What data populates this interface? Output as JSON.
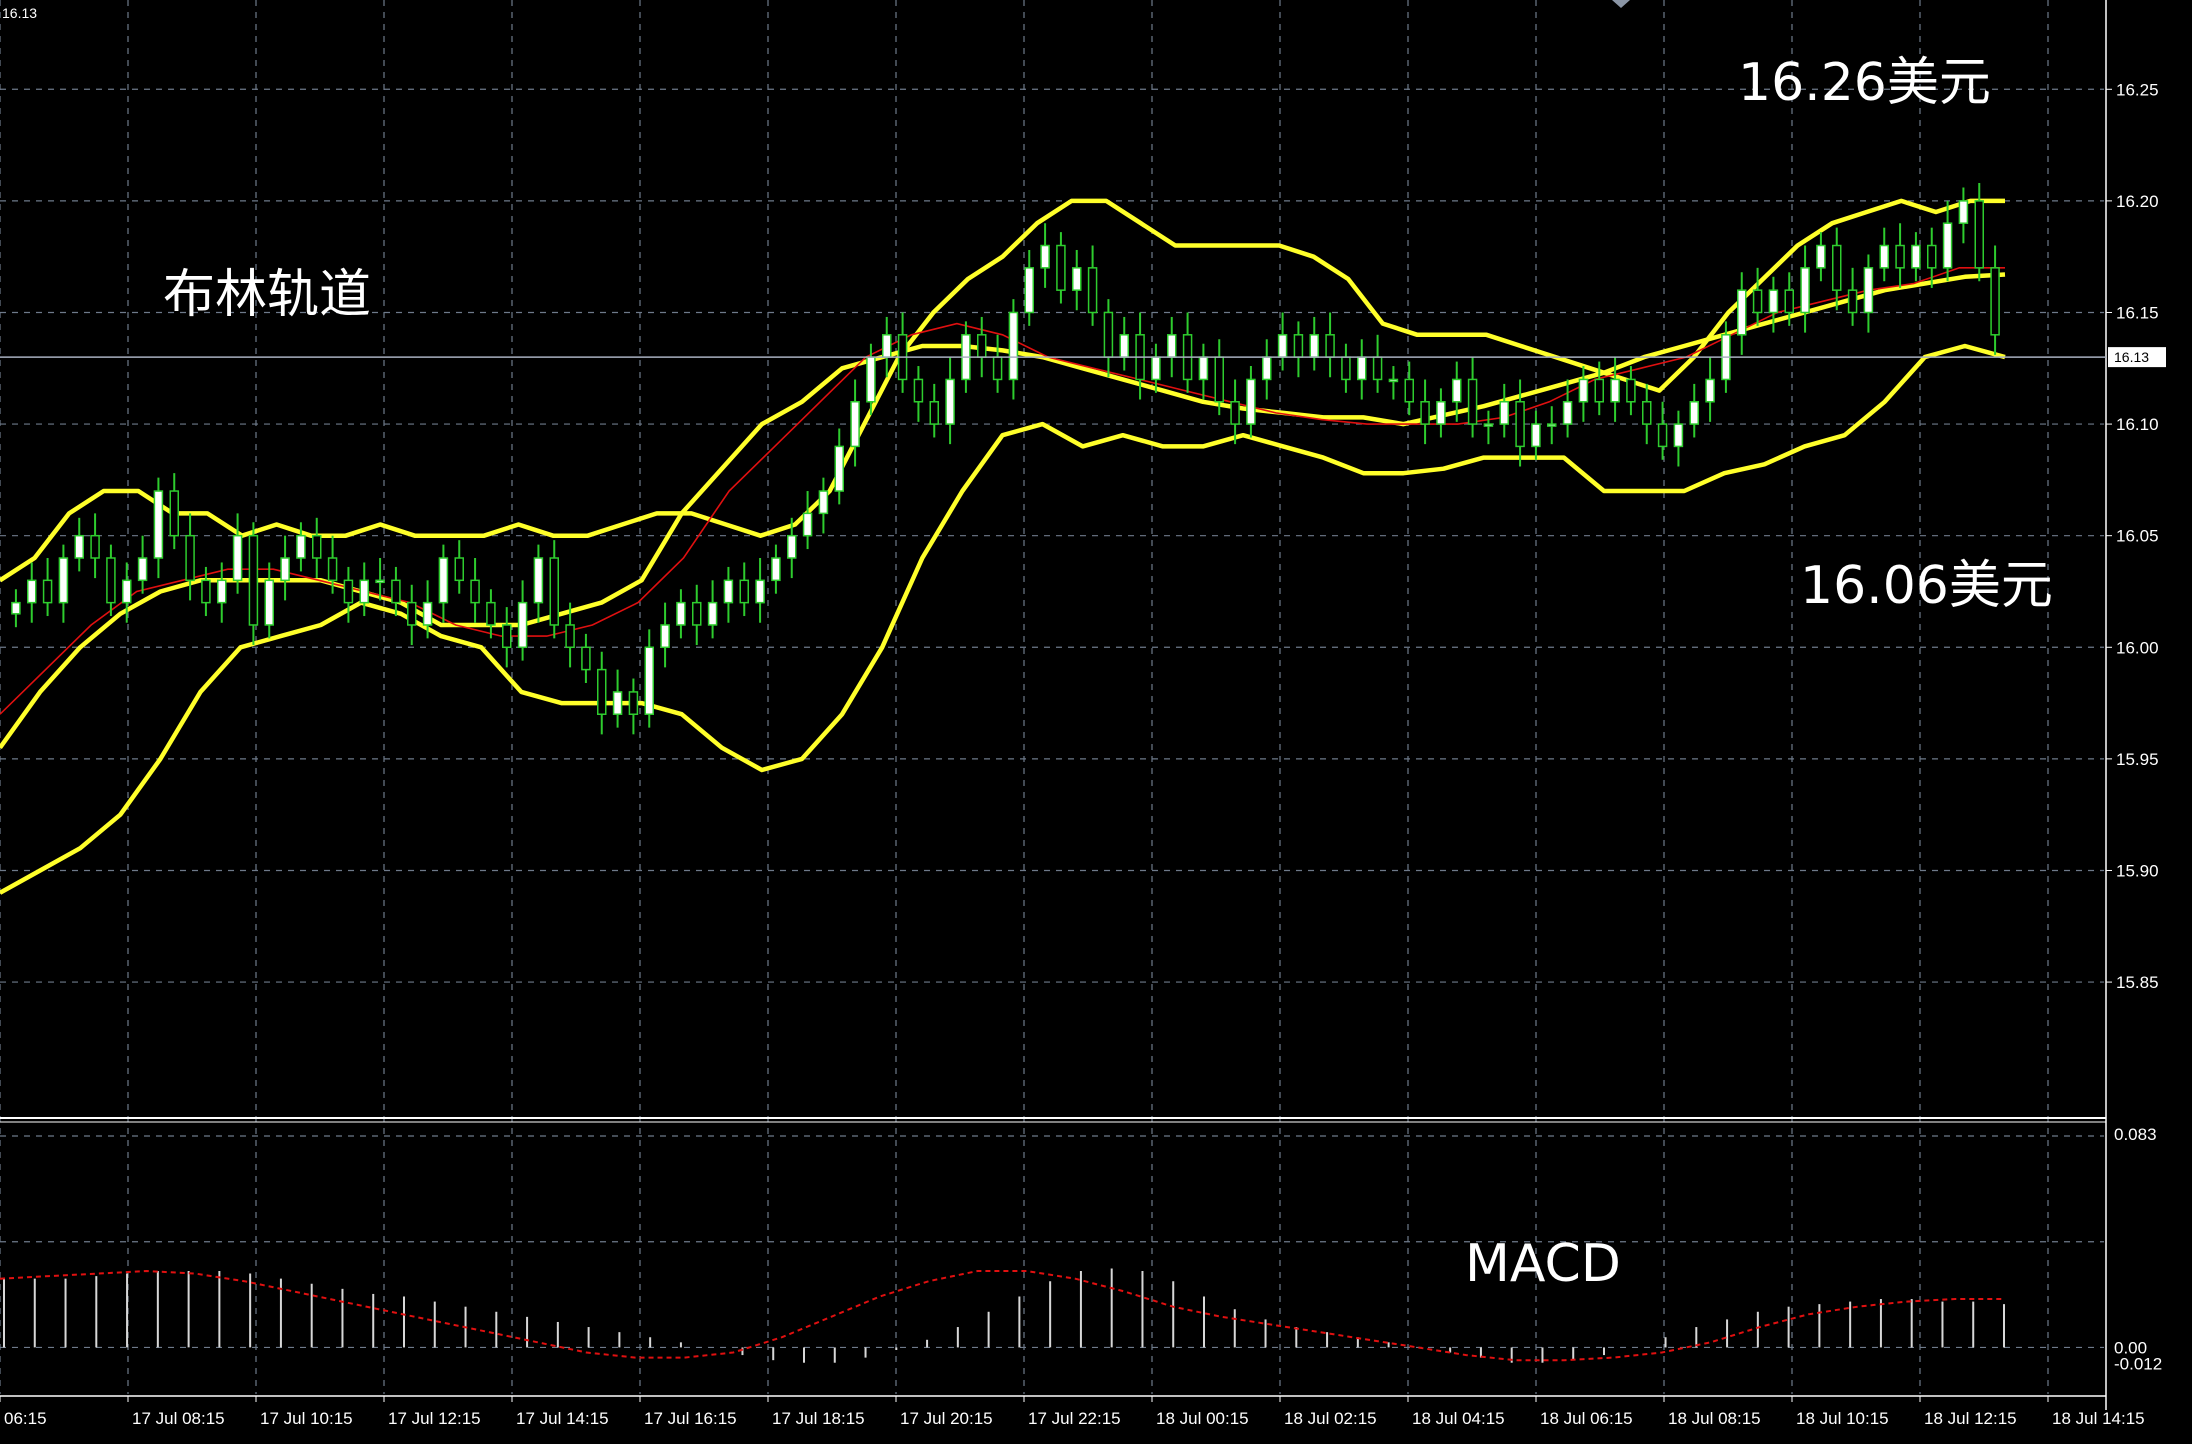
{
  "window": {
    "symbol_price": "16.13",
    "current_price_label": "16.13"
  },
  "annotations": {
    "bollinger": "布林轨道",
    "upper_price": "16.26美元",
    "lower_price": "16.06美元",
    "macd": "MACD"
  },
  "colors": {
    "background": "#000000",
    "grid": "#6e7a8a",
    "candle_body": "#ffffff",
    "candle_wick": "#2ecc2e",
    "bollinger": "#ffff2a",
    "moving_average": "#e01010",
    "macd_hist": "#d8d8d8",
    "macd_signal": "#e01010"
  },
  "chart_data": [
    {
      "type": "candlestick",
      "indicator": "Bollinger Bands",
      "ylim": [
        15.79,
        16.29
      ],
      "y_ticks": [
        15.85,
        15.9,
        15.95,
        16.0,
        16.05,
        16.1,
        16.15,
        16.2,
        16.25
      ],
      "y_tick_labels": [
        "15.85",
        "15.90",
        "15.95",
        "16.00",
        "16.05",
        "16.10",
        "16.15",
        "16.20",
        "16.25"
      ],
      "x_labels": [
        "06:15",
        "17 Jul 08:15",
        "17 Jul 10:15",
        "17 Jul 12:15",
        "17 Jul 14:15",
        "17 Jul 16:15",
        "17 Jul 18:15",
        "17 Jul 20:15",
        "17 Jul 22:15",
        "18 Jul 00:15",
        "18 Jul 02:15",
        "18 Jul 04:15",
        "18 Jul 06:15",
        "18 Jul 08:15",
        "18 Jul 10:15",
        "18 Jul 12:15",
        "18 Jul 14:15"
      ],
      "current_price": 16.13,
      "close": [
        16.02,
        16.03,
        16.02,
        16.04,
        16.05,
        16.04,
        16.02,
        16.03,
        16.04,
        16.07,
        16.05,
        16.03,
        16.02,
        16.03,
        16.05,
        16.01,
        16.03,
        16.04,
        16.05,
        16.04,
        16.03,
        16.02,
        16.03,
        16.03,
        16.02,
        16.01,
        16.02,
        16.04,
        16.03,
        16.02,
        16.01,
        16.0,
        16.02,
        16.04,
        16.01,
        16.0,
        15.99,
        15.97,
        15.98,
        15.97,
        16.0,
        16.01,
        16.02,
        16.01,
        16.02,
        16.03,
        16.02,
        16.03,
        16.04,
        16.05,
        16.06,
        16.07,
        16.09,
        16.11,
        16.13,
        16.14,
        16.12,
        16.11,
        16.1,
        16.12,
        16.14,
        16.13,
        16.12,
        16.15,
        16.17,
        16.18,
        16.16,
        16.17,
        16.15,
        16.13,
        16.14,
        16.12,
        16.13,
        16.14,
        16.12,
        16.13,
        16.11,
        16.1,
        16.12,
        16.13,
        16.14,
        16.13,
        16.14,
        16.13,
        16.12,
        16.13,
        16.12,
        16.12,
        16.11,
        16.1,
        16.11,
        16.12,
        16.1,
        16.1,
        16.11,
        16.09,
        16.1,
        16.1,
        16.11,
        16.12,
        16.11,
        16.12,
        16.11,
        16.1,
        16.09,
        16.1,
        16.11,
        16.12,
        16.14,
        16.16,
        16.15,
        16.16,
        16.15,
        16.17,
        16.18,
        16.16,
        16.15,
        16.17,
        16.18,
        16.17,
        16.18,
        16.17,
        16.19,
        16.2,
        16.17,
        16.14
      ],
      "bollinger_upper": [
        16.03,
        16.04,
        16.06,
        16.07,
        16.07,
        16.06,
        16.06,
        16.05,
        16.055,
        16.05,
        16.05,
        16.055,
        16.05,
        16.05,
        16.05,
        16.055,
        16.05,
        16.05,
        16.055,
        16.06,
        16.06,
        16.055,
        16.05,
        16.055,
        16.07,
        16.1,
        16.13,
        16.15,
        16.165,
        16.175,
        16.19,
        16.2,
        16.2,
        16.19,
        16.18,
        16.18,
        16.18,
        16.18,
        16.175,
        16.165,
        16.145,
        16.14,
        16.14,
        16.14,
        16.135,
        16.13,
        16.125,
        16.12,
        16.115,
        16.13,
        16.15,
        16.165,
        16.18,
        16.19,
        16.195,
        16.2,
        16.195,
        16.2,
        16.2
      ],
      "bollinger_middle": [
        15.955,
        15.98,
        16.0,
        16.015,
        16.025,
        16.03,
        16.03,
        16.03,
        16.03,
        16.025,
        16.02,
        16.01,
        16.01,
        16.01,
        16.015,
        16.02,
        16.03,
        16.06,
        16.08,
        16.1,
        16.11,
        16.125,
        16.13,
        16.135,
        16.135,
        16.133,
        16.13,
        16.125,
        16.12,
        16.115,
        16.11,
        16.107,
        16.105,
        16.103,
        16.103,
        16.1,
        16.104,
        16.108,
        16.113,
        16.118,
        16.123,
        16.13,
        16.135,
        16.14,
        16.145,
        16.15,
        16.155,
        16.16,
        16.163,
        16.166,
        16.167
      ],
      "moving_average": [
        15.97,
        15.99,
        16.01,
        16.025,
        16.03,
        16.035,
        16.035,
        16.03,
        16.025,
        16.02,
        16.01,
        16.005,
        16.005,
        16.01,
        16.02,
        16.04,
        16.07,
        16.09,
        16.11,
        16.13,
        16.14,
        16.145,
        16.14,
        16.13,
        16.125,
        16.12,
        16.115,
        16.11,
        16.105,
        16.102,
        16.1,
        16.1,
        16.1,
        16.103,
        16.11,
        16.12,
        16.125,
        16.13,
        16.14,
        16.15,
        16.155,
        16.16,
        16.163,
        16.17,
        16.17
      ],
      "bollinger_lower": [
        15.89,
        15.9,
        15.91,
        15.925,
        15.95,
        15.98,
        16.0,
        16.005,
        16.01,
        16.02,
        16.015,
        16.005,
        16.0,
        15.98,
        15.975,
        15.975,
        15.975,
        15.97,
        15.955,
        15.945,
        15.95,
        15.97,
        16.0,
        16.04,
        16.07,
        16.095,
        16.1,
        16.09,
        16.095,
        16.09,
        16.09,
        16.095,
        16.09,
        16.085,
        16.078,
        16.078,
        16.08,
        16.085,
        16.085,
        16.085,
        16.07,
        16.07,
        16.07,
        16.078,
        16.082,
        16.09,
        16.095,
        16.11,
        16.13,
        16.135,
        16.13
      ]
    },
    {
      "type": "bar",
      "indicator": "MACD",
      "ylim": [
        -0.012,
        0.083
      ],
      "y_tick_labels": [
        "0.083",
        "0.00",
        "-0.012"
      ],
      "histogram": [
        0.027,
        0.027,
        0.027,
        0.028,
        0.029,
        0.03,
        0.03,
        0.03,
        0.029,
        0.027,
        0.025,
        0.023,
        0.021,
        0.02,
        0.018,
        0.016,
        0.014,
        0.012,
        0.01,
        0.008,
        0.006,
        0.004,
        0.002,
        0.0,
        -0.003,
        -0.005,
        -0.006,
        -0.006,
        -0.004,
        -0.001,
        0.003,
        0.008,
        0.014,
        0.02,
        0.026,
        0.03,
        0.031,
        0.03,
        0.026,
        0.02,
        0.015,
        0.011,
        0.008,
        0.006,
        0.004,
        0.002,
        0.0,
        -0.002,
        -0.004,
        -0.006,
        -0.006,
        -0.005,
        -0.003,
        0.0,
        0.004,
        0.008,
        0.011,
        0.014,
        0.016,
        0.017,
        0.018,
        0.019,
        0.019,
        0.018,
        0.018,
        0.017
      ],
      "signal": [
        0.027,
        0.028,
        0.029,
        0.03,
        0.029,
        0.026,
        0.022,
        0.018,
        0.014,
        0.01,
        0.006,
        0.002,
        -0.002,
        -0.004,
        -0.004,
        -0.002,
        0.004,
        0.012,
        0.02,
        0.026,
        0.03,
        0.03,
        0.027,
        0.022,
        0.016,
        0.012,
        0.009,
        0.006,
        0.003,
        0.0,
        -0.003,
        -0.005,
        -0.005,
        -0.004,
        -0.002,
        0.002,
        0.008,
        0.013,
        0.016,
        0.018,
        0.019,
        0.019
      ]
    }
  ]
}
